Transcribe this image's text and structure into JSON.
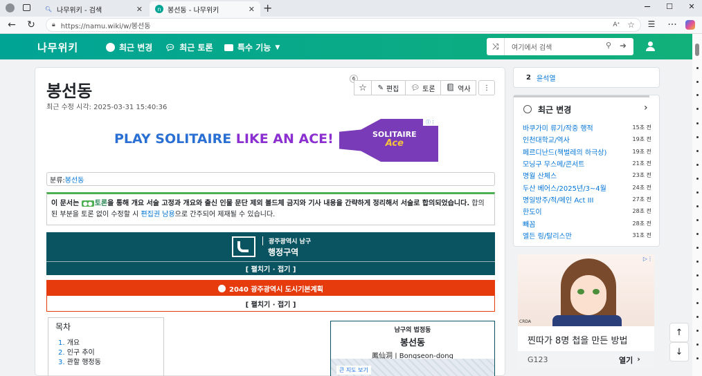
{
  "browser": {
    "tabs": [
      {
        "label": "나무위키 - 검색"
      },
      {
        "label": "봉선동 - 나무위키"
      }
    ],
    "url": "https://namu.wiki/w/봉선동",
    "window": {
      "min": "─",
      "max": "☐",
      "close": "✕"
    }
  },
  "site": {
    "logo": "나무위키",
    "nav": [
      {
        "label": "최근 변경"
      },
      {
        "label": "최근 토론"
      },
      {
        "label": "특수 기능"
      }
    ],
    "search_placeholder": "여기에서 검색"
  },
  "article": {
    "title": "봉선동",
    "modified": "최근 수정 시각: 2025-03-31 15:40:36",
    "star_count": "6",
    "tools": [
      {
        "label": "편집"
      },
      {
        "label": "토론"
      },
      {
        "label": "역사"
      }
    ],
    "ad_text_a": "PLAY SOLITAIRE ",
    "ad_text_b": "LIKE AN ACE!",
    "ad_logo_a": "SOLITAIRE",
    "ad_logo_b": "Ace",
    "category_label": "분류:",
    "category_value": "봉선동",
    "notice_a": "이 문서는 ",
    "notice_badge": "토론",
    "notice_b": "을 통해 개요 서술 고정과 개요와 출신 인물 문단 제외 볼드체 금지와 기사 내용을 간략하게 정리해서 서술로 합의되었습니다.",
    "notice_c": " 합의된 부분을 토론 없이 수정할 시 ",
    "notice_link": "편집권 남용",
    "notice_d": "으로 간주되어 제재될 수 있습니다.",
    "navbox1": {
      "sub": "광주광역시 남구",
      "main": "행정구역",
      "toggle": "[ 펼치기 · 접기 ]"
    },
    "navbox2": {
      "head": "2040 광주광역시 도시기본계획",
      "toggle": "[ 펼치기 · 접기 ]"
    },
    "toc": {
      "title": "목차",
      "items": [
        {
          "n": "1.",
          "label": "개요"
        },
        {
          "n": "2.",
          "label": "인구 추이"
        },
        {
          "n": "3.",
          "label": "관할 행정동"
        }
      ]
    },
    "infobox": {
      "caption": "남구의 법정동",
      "name": "봉선동",
      "hanja": "鳳仙洞 | Bongseon-dong",
      "map_btn": "큰 지도 보기"
    }
  },
  "sidebar": {
    "trending": {
      "rank": "2",
      "label": "윤석열"
    },
    "recent": {
      "title": "최근 변경",
      "items": [
        {
          "title": "바쿠가미 류기/작중 행적",
          "time": "15초 전"
        },
        {
          "title": "인천대학교/역사",
          "time": "19초 전"
        },
        {
          "title": "페르디난드(책벌레의 하극상)",
          "time": "19초 전"
        },
        {
          "title": "모닝구 무스메/콘서트",
          "time": "21초 전"
        },
        {
          "title": "명월 산체스",
          "time": "23초 전"
        },
        {
          "title": "두산 베어스/2025년/3~4월",
          "time": "24초 전"
        },
        {
          "title": "명일방주/적/메인 Act III",
          "time": "27초 전"
        },
        {
          "title": "한도이",
          "time": "28초 전"
        },
        {
          "title": "빼꼼",
          "time": "28초 전"
        },
        {
          "title": "엘든 링/탈리스만",
          "time": "31초 전"
        }
      ]
    },
    "ad": {
      "brand": "CRDA",
      "headline": "찐따가 8명 첩을 만든 방법",
      "source": "G123",
      "cta": "열기"
    }
  },
  "icons": [
    "search-icon",
    "star-icon",
    "pencil-icon",
    "chat-icon",
    "book-icon",
    "shuffle-icon",
    "arrow-right-icon",
    "user-icon",
    "clock-icon",
    "chevron-right-icon",
    "arrow-up-icon",
    "arrow-down-icon"
  ],
  "colors": {
    "brand": "#00a495",
    "navbox": "#0a5360",
    "plan": "#e53b0d",
    "link": "#0275d8"
  }
}
